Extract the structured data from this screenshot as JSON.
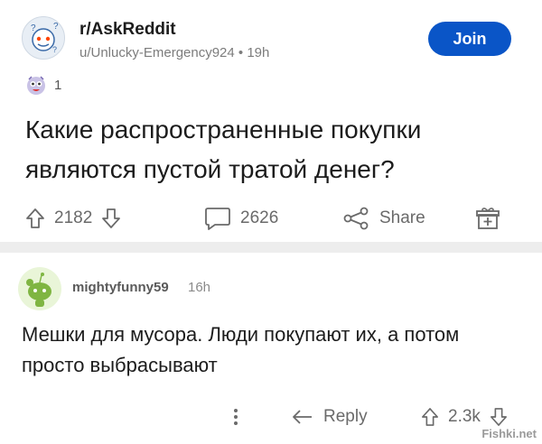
{
  "post": {
    "subreddit": "r/AskReddit",
    "author_meta": "u/Unlucky-Emergency924 • 19h",
    "join_label": "Join",
    "award_count": "1",
    "title": "Какие распространенные покупки являются пустой тратой денег?",
    "upvotes": "2182",
    "comments": "2626",
    "share_label": "Share"
  },
  "comment": {
    "username": "mightyfunny59",
    "time": "16h",
    "body": "Мешки для мусора. Люди покупают их, а потом просто выбрасывают",
    "reply_label": "Reply",
    "votes": "2.3k"
  },
  "watermark": "Fishki.net",
  "colors": {
    "join_bg": "#0a55c7",
    "separator": "#ededed"
  }
}
